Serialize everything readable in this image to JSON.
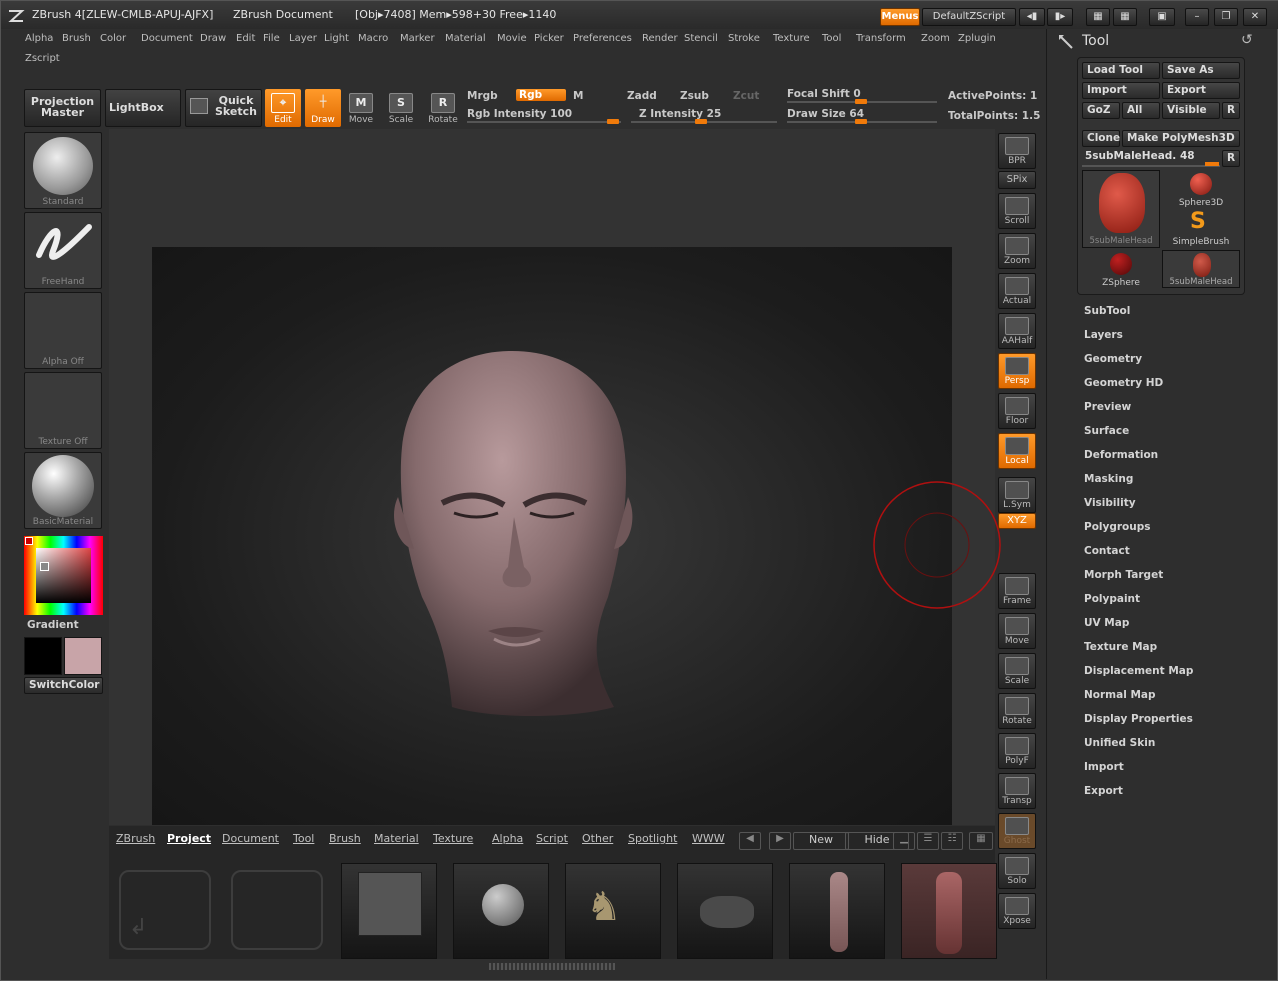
{
  "title": {
    "app": "ZBrush 4[ZLEW-CMLB-APUJ-AJFX]",
    "document": "ZBrush Document",
    "stats": "[Obj▸7408]  Mem▸598+30  Free▸1140",
    "menus_btn": "Menus",
    "script_btn": "DefaultZScript"
  },
  "menubar": [
    "Alpha",
    "Brush",
    "Color",
    "Document",
    "Draw",
    "Edit",
    "File",
    "Layer",
    "Light",
    "Macro",
    "Marker",
    "Material",
    "Movie",
    "Picker",
    "Preferences",
    "Render",
    "Stencil",
    "Stroke",
    "Texture",
    "Tool",
    "Transform",
    "Zoom",
    "Zplugin",
    "Zscript"
  ],
  "toolbar": {
    "projection_master": "Projection Master",
    "lightbox": "LightBox",
    "quick_sketch": "Quick Sketch",
    "edit": "Edit",
    "draw": "Draw",
    "move": "Move",
    "scale": "Scale",
    "rotate": "Rotate",
    "mrgb": "Mrgb",
    "rgb": "Rgb",
    "m": "M",
    "rgb_intensity": "Rgb Intensity 100",
    "zadd": "Zadd",
    "zsub": "Zsub",
    "zcut": "Zcut",
    "z_intensity": "Z Intensity 25",
    "focal_shift": "Focal Shift 0",
    "draw_size": "Draw Size 64",
    "active_points": "ActivePoints: 1",
    "total_points": "TotalPoints: 1.5"
  },
  "left_shelf": {
    "brush": "Standard",
    "stroke": "FreeHand",
    "alpha": "Alpha  Off",
    "texture": "Texture  Off",
    "material": "BasicMaterial",
    "gradient": "Gradient",
    "switch_color": "SwitchColor"
  },
  "right_shelf": [
    "BPR",
    "SPix",
    "Scroll",
    "Zoom",
    "Actual",
    "AAHalf",
    "Persp",
    "Floor",
    "Local",
    "L.Sym",
    "XYZ",
    "Frame",
    "Move",
    "Scale",
    "Rotate",
    "PolyF",
    "Transp",
    "Ghost",
    "Solo",
    "Xpose"
  ],
  "tool_panel": {
    "title": "Tool",
    "load_tool": "Load Tool",
    "save_as": "Save As",
    "import": "Import",
    "export": "Export",
    "goz": "GoZ",
    "all": "All",
    "visible": "Visible",
    "r": "R",
    "clone": "Clone",
    "make_polymesh": "Make PolyMesh3D",
    "current_tool": "5subMaleHead. 48",
    "tools": [
      "5subMaleHead",
      "Sphere3D",
      "SimpleBrush",
      "ZSphere",
      "5subMaleHead"
    ],
    "sections": [
      "SubTool",
      "Layers",
      "Geometry",
      "Geometry HD",
      "Preview",
      "Surface",
      "Deformation",
      "Masking",
      "Visibility",
      "Polygroups",
      "Contact",
      "Morph Target",
      "Polypaint",
      "UV Map",
      "Texture Map",
      "Displacement Map",
      "Normal Map",
      "Display Properties",
      "Unified Skin",
      "Import",
      "Export"
    ]
  },
  "lightbox": {
    "tabs": [
      "ZBrush",
      "Project",
      "Document",
      "Tool",
      "Brush",
      "Material",
      "Texture",
      "Alpha",
      "Script",
      "Other",
      "Spotlight",
      "WWW"
    ],
    "new": "New",
    "hide": "Hide"
  },
  "colors": {
    "accent": "#f07a0a",
    "primary_color": "#000000",
    "secondary_color": "#c8a4a8"
  }
}
